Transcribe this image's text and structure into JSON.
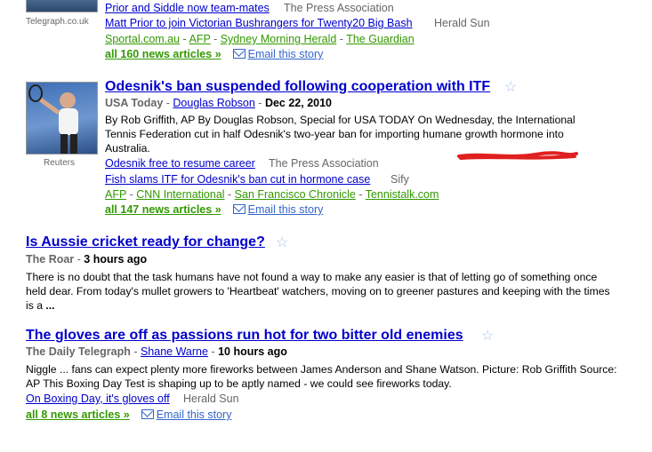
{
  "top_story": {
    "thumb_caption": "Telegraph.co.uk",
    "related": [
      {
        "title": "Prior and Siddle now team-mates",
        "source": "The Press Association"
      },
      {
        "title": "Matt Prior to join Victorian Bushrangers for Twenty20 Big Bash",
        "source": "Herald Sun"
      }
    ],
    "sources": [
      "Sportal.com.au",
      "AFP",
      "Sydney Morning Herald",
      "The Guardian"
    ],
    "all_articles": "all 160 news articles »",
    "email": "Email this story"
  },
  "odesnik": {
    "title": "Odesnik's ban suspended following cooperation with ITF",
    "source": "USA Today",
    "author": "Douglas Robson",
    "date": "Dec 22, 2010",
    "snippet": "By Rob Griffith, AP By Douglas Robson, Special for USA TODAY On Wednesday, the International Tennis Federation cut in half Odesnik's two-year ban for importing humane growth hormone into Australia.",
    "thumb_caption": "Reuters",
    "related": [
      {
        "title": "Odesnik free to resume career",
        "source": "The Press Association"
      },
      {
        "title": "Fish slams ITF for Odesnik's ban cut in hormone case",
        "source": "Sify"
      }
    ],
    "sources": [
      "AFP",
      "CNN International",
      "San Francisco Chronicle",
      "Tennistalk.com"
    ],
    "all_articles": "all 147 news articles »",
    "email": "Email this story"
  },
  "cricket": {
    "title": "Is Aussie cricket ready for change?",
    "source": "The Roar",
    "time": "3 hours ago",
    "snippet": "There is no doubt that the task humans have not found a way to make any easier is that of letting go of something once held dear. From today's mullet growers to 'Heartbeat' watchers, moving on to greener pastures and keeping with the times is a",
    "ellipsis": "..."
  },
  "gloves": {
    "title": "The gloves are off as passions run hot for two bitter old enemies",
    "source": "The Daily Telegraph",
    "author": "Shane Warne",
    "time": "10 hours ago",
    "snippet": "Niggle ... fans can expect plenty more fireworks between James Anderson and Shane Watson. Picture: Rob Griffith Source: AP This Boxing Day Test is shaping up to be aptly named - we could see fireworks today.",
    "related": [
      {
        "title": "On Boxing Day, it's gloves off",
        "source": "Herald Sun"
      }
    ],
    "all_articles": "all 8 news articles »",
    "email": "Email this story"
  },
  "separators": {
    "dash": " - "
  },
  "colors": {
    "link": "#0000cc",
    "source_link": "#339900",
    "email": "#3366cc",
    "star": "#a8c4e8",
    "scribble": "#e02020"
  }
}
